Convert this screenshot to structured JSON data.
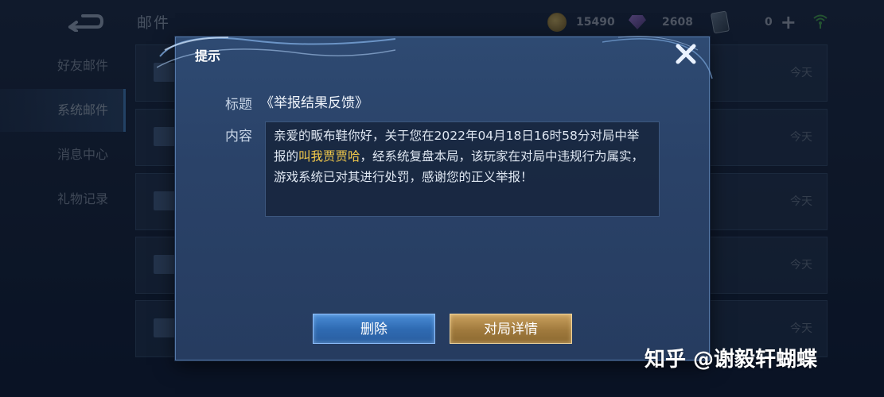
{
  "header": {
    "title": "邮件",
    "gold": "15490",
    "diamonds": "2608",
    "tickets": "0"
  },
  "sidebar": {
    "items": [
      {
        "label": "好友邮件"
      },
      {
        "label": "系统邮件"
      },
      {
        "label": "消息中心"
      },
      {
        "label": "礼物记录"
      }
    ]
  },
  "mail_list": {
    "dates": [
      "今天",
      "今天",
      "今天",
      "今天",
      "今天"
    ]
  },
  "dialog": {
    "title": "提示",
    "subject_label": "标题",
    "subject": "《举报结果反馈》",
    "content_label": "内容",
    "content_part1": "亲爱的畈布鞋你好，关于您在2022年04月18日16时58分对局中举报的",
    "content_highlight": "叫我贾贾哈",
    "content_part2": "，经系统复盘本局，该玩家在对局中违规行为属实，游戏系统已对其进行处罚，感谢您的正义举报！",
    "delete_label": "删除",
    "detail_label": "对局详情"
  },
  "watermark": "知乎 @谢毅轩蝴蝶",
  "colors": {
    "highlight": "#f1c84a",
    "delete_button": "#2f6bb3",
    "detail_button": "#a07a3d",
    "dialog_bg": "#2a4268"
  }
}
